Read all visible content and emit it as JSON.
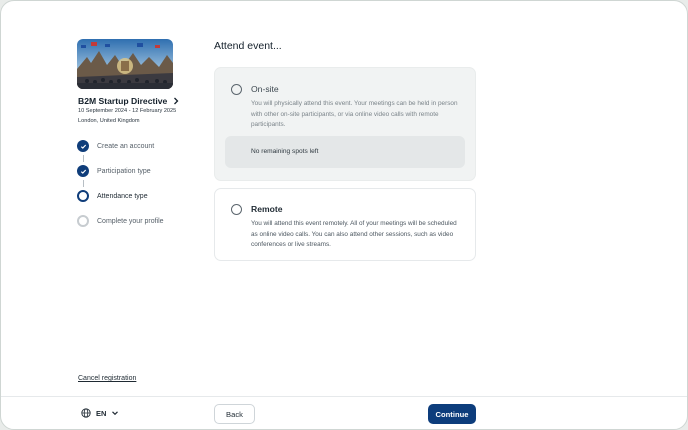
{
  "event": {
    "title": "B2M Startup Directive",
    "dates": "10 September 2024 - 12 February 2025",
    "location": "London, United Kingdom"
  },
  "steps": [
    {
      "label": "Create an account",
      "state": "done"
    },
    {
      "label": "Participation type",
      "state": "done"
    },
    {
      "label": "Attendance type",
      "state": "current"
    },
    {
      "label": "Complete your profile",
      "state": "todo"
    }
  ],
  "cancel_label": "Cancel registration",
  "main": {
    "title": "Attend event...",
    "options": {
      "onsite": {
        "title": "On-site",
        "description": "You will physically attend this event. Your meetings can be held in person with other on-site participants, or via online video calls with remote participants.",
        "notice": "No remaining spots left",
        "disabled": true
      },
      "remote": {
        "title": "Remote",
        "description": "You will attend this event remotely. All of your meetings will be scheduled as online video calls. You can also attend other sessions, such as video conferences or live streams.",
        "disabled": false
      }
    }
  },
  "footer": {
    "language": "EN",
    "back_label": "Back",
    "continue_label": "Continue"
  },
  "colors": {
    "primary": "#0d3d7c",
    "border": "#e6e9eb",
    "muted_text": "#6b757c"
  }
}
